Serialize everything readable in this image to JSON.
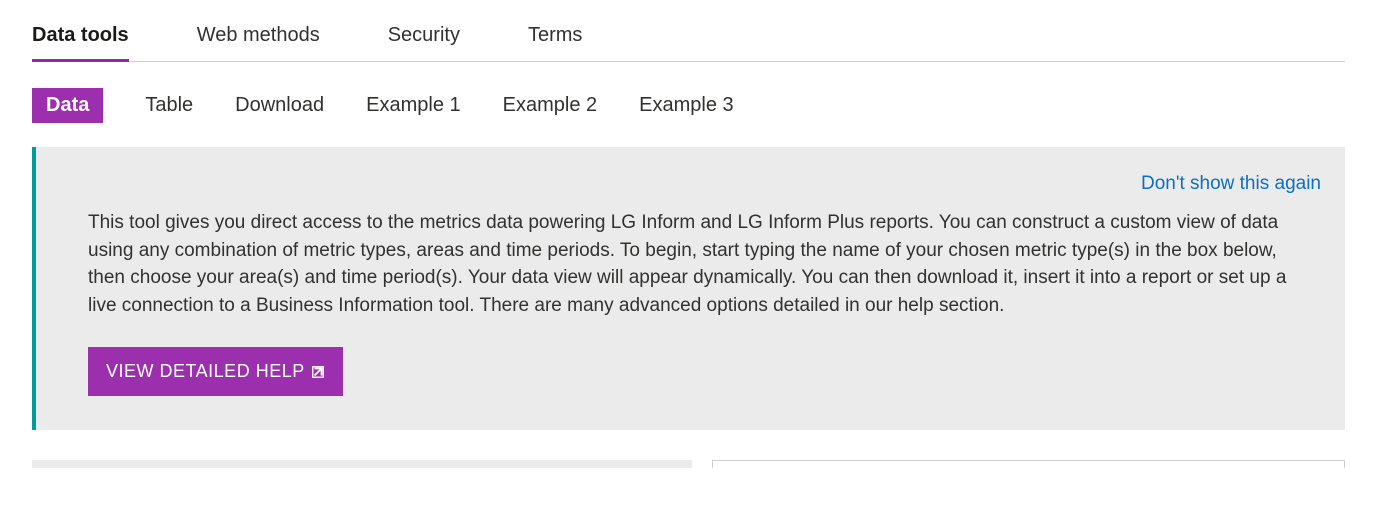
{
  "primaryTabs": {
    "items": [
      {
        "label": "Data tools",
        "active": true
      },
      {
        "label": "Web methods",
        "active": false
      },
      {
        "label": "Security",
        "active": false
      },
      {
        "label": "Terms",
        "active": false
      }
    ]
  },
  "secondaryTabs": {
    "items": [
      {
        "label": "Data",
        "active": true
      },
      {
        "label": "Table",
        "active": false
      },
      {
        "label": "Download",
        "active": false
      },
      {
        "label": "Example 1",
        "active": false
      },
      {
        "label": "Example 2",
        "active": false
      },
      {
        "label": "Example 3",
        "active": false
      }
    ]
  },
  "infoPanel": {
    "dismiss": "Don't show this again",
    "body": "This tool gives you direct access to the metrics data powering LG Inform and LG Inform Plus reports. You can construct a custom view of data using any combination of metric types, areas and time periods. To begin, start typing the name of your chosen metric type(s) in the box below, then choose your area(s) and time period(s). Your data view will appear dynamically. You can then download it, insert it into a report or set up a live connection to a Business Information tool. There are many advanced options detailed in our help section.",
    "helpButton": "VIEW DETAILED HELP"
  }
}
